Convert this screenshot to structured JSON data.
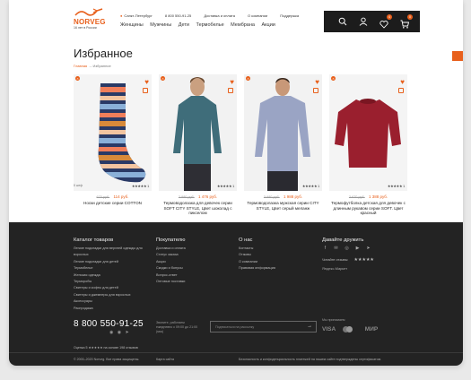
{
  "header": {
    "logo_text": "NORVEG",
    "logo_tagline": "16 лет в России",
    "city": "Санкт-Петербург",
    "phone": "8 800 550-91-25",
    "links": [
      "Доставка и оплата",
      "О компании",
      "Поддержка"
    ],
    "nav": [
      "Женщины",
      "Мужчины",
      "Дети",
      "Термобелье",
      "Мембрана",
      "Акции"
    ],
    "favorites_count": "4",
    "cart_count": "0"
  },
  "page": {
    "title": "Избранное",
    "breadcrumb_home": "Главная",
    "breadcrumb_current": "Избранное"
  },
  "products": [
    {
      "article": "0 шт/р",
      "old_price": "670 руб.",
      "new_price": "114 руб.",
      "name": "Носки детские серии COTTON",
      "kind": "socks"
    },
    {
      "article": "",
      "old_price": "2 980 руб.",
      "new_price": "1 476 руб.",
      "name": "Термоводолазка для девочек серии SOFT CITY STYLE, Цвет шоколад с пикселом",
      "kind": "girl"
    },
    {
      "article": "",
      "old_price": "3 980 руб.",
      "new_price": "1 988 руб.",
      "name": "Термоводолазка мужская серии CITY STYLE, Цвет серый меланж",
      "kind": "man"
    },
    {
      "article": "",
      "old_price": "2 670 руб.",
      "new_price": "1 388 руб.",
      "name": "Термофутболка детская для девочек с длинным рукавом серии SOFT. Цвет красный",
      "kind": "shirt"
    }
  ],
  "footer": {
    "catalog_title": "Каталог товаров",
    "catalog_items": [
      "Легкие подкладки для верхней одежды для взрослых",
      "Легкие подкладки для детей",
      "Термобелье",
      "Женская одежда",
      "Терморобы",
      "Свитеры и кофты для детей",
      "Свитеры и джемперы для взрослых",
      "Аксессуары",
      "Распродажа"
    ],
    "buyers_title": "Покупателю",
    "buyers_items": [
      "Доставка и оплата",
      "Статус заказа",
      "Акции",
      "Скидки и бонусы",
      "Вопрос-ответ",
      "Оптовые поставки"
    ],
    "about_title": "О нас",
    "about_items": [
      "Контакты",
      "Отзывы",
      "О компании",
      "Правовая информация"
    ],
    "friends_title": "Давайте дружить",
    "social": [
      "f",
      "✉",
      "◎",
      "▶",
      "➤"
    ],
    "rating_label": "Читайте отзывы",
    "market_label": "Яндекс.Маркет",
    "phone": "8 800 550-91-25",
    "hours": "Звоните, работаем ежедневно с 09:00 до 21:00 (мск)",
    "subscribe_placeholder": "Подписаться на рассылку",
    "rating_text": "Оценка 5 ★★★★★ на основе 198 отзывов",
    "pay_label": "Мы принимаем",
    "pay_logos": [
      "VISA",
      "МИР"
    ],
    "copyright": "© 2000–2020 Norveg. Все права защищены.",
    "sitemap": "Карта сайта",
    "policy": "Безопасность и конфиденциальность платежей на нашем сайте подтверждены сертификатом."
  },
  "colors": {
    "accent": "#e8601c",
    "dark": "#232323"
  }
}
